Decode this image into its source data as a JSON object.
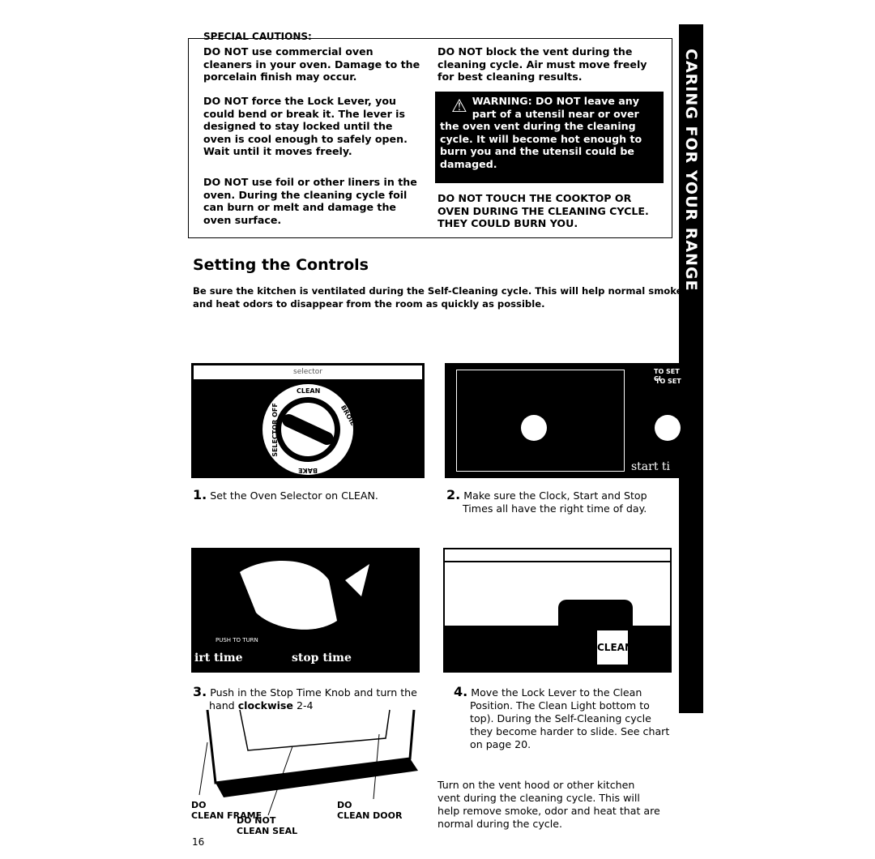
{
  "cautions": {
    "title": "SPECIAL CAUTIONS:",
    "left": [
      "DO NOT use commercial oven cleaners in your oven. Damage to the porcelain finish may occur.",
      "DO NOT force the Lock Lever, you could bend or break it. The lever is designed to stay locked until the oven is cool enough to safely open. Wait until it moves freely.",
      "DO NOT use foil or other liners in the oven. During the cleaning cycle foil can burn or melt and damage the oven surface."
    ],
    "right_top": "DO NOT block the vent during the cleaning cycle. Air must move freely for best cleaning results.",
    "warning": "WARNING: DO NOT leave any part of a utensil near or over the oven vent during the cleaning cycle. It will become hot enough to burn you and the utensil could be damaged.",
    "right_bottom": "DO NOT TOUCH THE COOKTOP OR OVEN DURING THE CLEANING CYCLE. THEY COULD BURN YOU."
  },
  "side_tab": "CARING FOR YOUR RANGE",
  "section_title": "Setting the Controls",
  "intro": "Be sure the kitchen is ventilated during the Self-Cleaning cycle. This will help normal smoke and heat odors to disappear from the room as quickly as possible.",
  "figures": {
    "selector_label": "selector",
    "dial_labels": [
      "CLEAN",
      "BROIL",
      "BAKE",
      "SELECTOR OFF"
    ],
    "clock_label": "TO SET CI",
    "clock_label2": "TO SET",
    "clock_start": "start ti",
    "knob_push": "PUSH TO TURN",
    "knob_start": "irt time",
    "knob_stop": "stop time",
    "lever_label": "CLEAN"
  },
  "steps": [
    {
      "num": "1.",
      "text": "Set the Oven Selector on CLEAN."
    },
    {
      "num": "2.",
      "text": "Make sure the Clock, Start and Stop Times all have the right time of day."
    },
    {
      "num": "3.",
      "text": "Push in the Stop Time Knob and turn the hand ",
      "bold": "clockwise",
      "tail": " 2-4"
    },
    {
      "num": "4.",
      "text": "Move the Lock Lever to the Clean Position. The Clean Light bottom to top). During the Self-Cleaning cycle they become harder to slide. See chart on page 20."
    }
  ],
  "vent_note": "Turn on the vent hood or other kitchen vent during the cleaning cycle. This will help remove smoke, odor and heat that are normal during the cycle.",
  "door_labels": {
    "frame": "DO\nCLEAN FRAME",
    "seal": "DO NOT\nCLEAN SEAL",
    "door": "DO\nCLEAN DOOR"
  },
  "page_number": "16"
}
